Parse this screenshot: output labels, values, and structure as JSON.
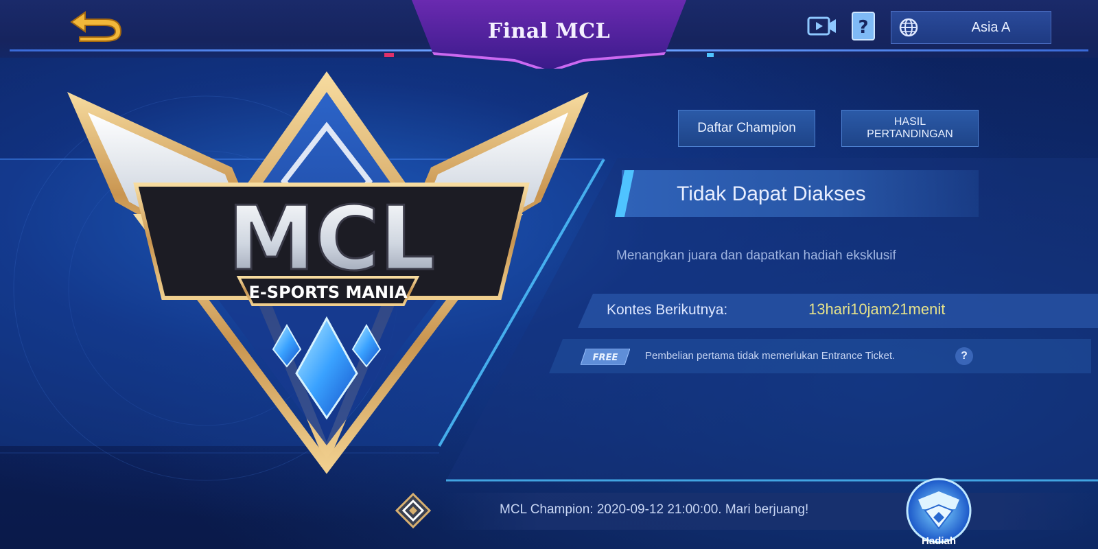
{
  "header": {
    "title": "Final MCL",
    "back_icon": "back-arrow-icon",
    "video_icon": "video-icon",
    "help_icon": "question-book-icon",
    "region": {
      "icon": "globe-icon",
      "label": "Asia A"
    }
  },
  "logo": {
    "main_text": "MCL",
    "sub_text": "E-SPORTS MANIA"
  },
  "panel": {
    "champion_button": "Daftar Champion",
    "results_button": "HASIL\nPERTANDINGAN",
    "status": "Tidak Dapat Diakses",
    "description": "Menangkan juara dan dapatkan hadiah eksklusif",
    "next_contest_label": "Kontes Berikutnya:",
    "next_contest_value": "13hari10jam21menit",
    "free_badge": "FREE",
    "free_note": "Pembelian pertama tidak memerlukan Entrance Ticket.",
    "free_help": "?"
  },
  "footer": {
    "ticker_icon": "diamond-emblem-icon",
    "ticker_text": "MCL Champion: 2020-09-12 21:00:00. Mari berjuang!",
    "reward_icon": "reward-crest-icon",
    "reward_label": "Hadiah"
  },
  "colors": {
    "background": "#0a1a4a",
    "panel_blue": "#2856a6",
    "accent_cyan": "#4fc3ff",
    "accent_pink": "#e0306a",
    "gold": "#d8b070",
    "timer_yellow": "#e6e28a"
  }
}
